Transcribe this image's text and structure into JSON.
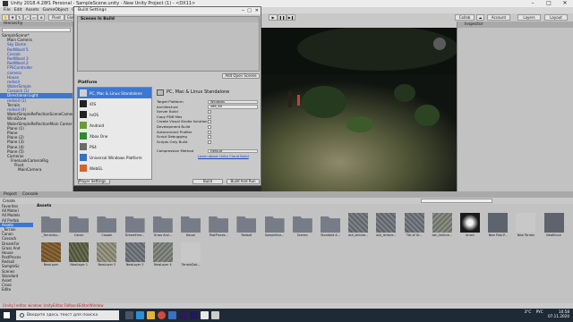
{
  "window": {
    "title": "Unity 2018.4.28f1 Personal - SampleScene.unity - New Unity Project (1) - <DX11>"
  },
  "menu": [
    "File",
    "Edit",
    "Assets",
    "GameObject",
    "Component",
    "Window",
    "Help"
  ],
  "toolbar": {
    "pivot": "Pivot",
    "space": "Global",
    "collab": "Collab",
    "account": "Account",
    "layers": "Layers",
    "layout": "Layout"
  },
  "hierarchy": {
    "title": "Hierarchy",
    "create": "Create",
    "items": [
      {
        "label": "SampleScene*",
        "cls": ""
      },
      {
        "label": "Main Camera",
        "cls": ""
      },
      {
        "label": "Sky Dome",
        "cls": "blue"
      },
      {
        "label": "RedWood 5",
        "cls": "blue"
      },
      {
        "label": "Cossak",
        "cls": "blue"
      },
      {
        "label": "RedWood 3",
        "cls": "blue"
      },
      {
        "label": "RedWood 2",
        "cls": "blue"
      },
      {
        "label": "FPSController",
        "cls": "blue"
      },
      {
        "label": "camera",
        "cls": "blue"
      },
      {
        "label": "House",
        "cls": "blue"
      },
      {
        "label": "redsoil",
        "cls": "blue"
      },
      {
        "label": "WaterSimple",
        "cls": "blue"
      },
      {
        "label": "Cossack (1)",
        "cls": "blue"
      },
      {
        "label": "Directional Light",
        "cls": "sel"
      },
      {
        "label": "redsoil (1)",
        "cls": "blue"
      },
      {
        "label": "Terrain",
        "cls": ""
      },
      {
        "label": "redsoil (4)",
        "cls": "blue"
      },
      {
        "label": "WaterSimpleReflectionSceneCamera",
        "cls": ""
      },
      {
        "label": "WindZone",
        "cls": ""
      },
      {
        "label": "WaterSimpleReflectionMain Camera",
        "cls": ""
      },
      {
        "label": "Plane (1)",
        "cls": ""
      },
      {
        "label": "Plane",
        "cls": ""
      },
      {
        "label": "Plane (2)",
        "cls": ""
      },
      {
        "label": "Plane (3)",
        "cls": ""
      },
      {
        "label": "Plane (4)",
        "cls": ""
      },
      {
        "label": "Plane (5)",
        "cls": ""
      },
      {
        "label": "Cameras",
        "cls": ""
      },
      {
        "label": "FreeLookCameraRig",
        "cls": ""
      },
      {
        "label": "Pivot",
        "cls": ""
      },
      {
        "label": "MainCamera",
        "cls": ""
      }
    ]
  },
  "inspector": {
    "title": "Inspector"
  },
  "build": {
    "title": "Build Settings",
    "scenes_header": "Scenes In Build",
    "add_open_scenes": "Add Open Scenes",
    "platform_header": "Platform",
    "platforms": [
      {
        "label": "PC, Mac & Linux Standalone",
        "color": "#d0d0d0"
      },
      {
        "label": "iOS",
        "color": "#222222"
      },
      {
        "label": "tvOS",
        "color": "#222222"
      },
      {
        "label": "Android",
        "color": "#6a9a3a"
      },
      {
        "label": "Xbox One",
        "color": "#2d8a2d"
      },
      {
        "label": "PS4",
        "color": "#6b6b6b"
      },
      {
        "label": "Universal Windows Platform",
        "color": "#3a6fc4"
      },
      {
        "label": "WebGL",
        "color": "#d9622b"
      }
    ],
    "selected_platform": "PC, Mac & Linux Standalone",
    "settings": [
      {
        "label": "Target Platform",
        "value": "Windows",
        "kind": "select"
      },
      {
        "label": "Architecture",
        "value": "x86_64",
        "kind": "select"
      },
      {
        "label": "Server Build",
        "value": "",
        "kind": "check"
      },
      {
        "label": "Copy PDB files",
        "value": "",
        "kind": "check"
      },
      {
        "label": "Create Visual Studio Solution",
        "value": "",
        "kind": "check"
      },
      {
        "label": "Development Build",
        "value": "",
        "kind": "check"
      },
      {
        "label": "Autoconnect Profiler",
        "value": "",
        "kind": "check"
      },
      {
        "label": "Script Debugging",
        "value": "",
        "kind": "check"
      },
      {
        "label": "Scripts Only Build",
        "value": "",
        "kind": "check"
      }
    ],
    "compression_label": "Compression Method",
    "compression_value": "Default",
    "cloud_link": "Learn about Unity Cloud Build",
    "player_settings": "Player Settings...",
    "build": "Build",
    "build_and_run": "Build And Run"
  },
  "project": {
    "tab_project": "Project",
    "tab_console": "Console",
    "create": "Create",
    "tree": [
      {
        "label": "Favorites",
        "cls": ""
      },
      {
        "label": "All Materi",
        "cls": ""
      },
      {
        "label": "All Models",
        "cls": ""
      },
      {
        "label": "All Prefab",
        "cls": ""
      },
      {
        "label": "Assets",
        "cls": "sel"
      },
      {
        "label": "_Terrain",
        "cls": ""
      },
      {
        "label": "Canon",
        "cls": ""
      },
      {
        "label": "Cossack",
        "cls": ""
      },
      {
        "label": "DreamFor",
        "cls": ""
      },
      {
        "label": "Grass And",
        "cls": ""
      },
      {
        "label": "House",
        "cls": ""
      },
      {
        "label": "PostProces",
        "cls": ""
      },
      {
        "label": "Redsoil",
        "cls": ""
      },
      {
        "label": "SampleSc",
        "cls": ""
      },
      {
        "label": "Scenes",
        "cls": ""
      },
      {
        "label": "Standard",
        "cls": ""
      },
      {
        "label": "Asset",
        "cls": ""
      },
      {
        "label": "Cross",
        "cls": ""
      },
      {
        "label": "Edito",
        "cls": ""
      }
    ],
    "crumb": "Assets",
    "assets": [
      {
        "label": "_TerrainAu...",
        "kind": "folder"
      },
      {
        "label": "Canon",
        "kind": "folder"
      },
      {
        "label": "Cossak",
        "kind": "folder"
      },
      {
        "label": "DreamFore...",
        "kind": "folder"
      },
      {
        "label": "Grass And...",
        "kind": "folder"
      },
      {
        "label": "House",
        "kind": "folder"
      },
      {
        "label": "PostProces...",
        "kind": "folder"
      },
      {
        "label": "Redsoil",
        "kind": "folder"
      },
      {
        "label": "SampleSce...",
        "kind": "folder"
      },
      {
        "label": "Scenes",
        "kind": "folder"
      },
      {
        "label": "Standard A...",
        "kind": "folder"
      },
      {
        "label": "ash_lenture...",
        "kind": "tex1"
      },
      {
        "label": "ash_lenture...",
        "kind": "tex1"
      },
      {
        "label": "Tile of Gr...",
        "kind": "tex1"
      },
      {
        "label": "ash_lenture...",
        "kind": "tex2"
      },
      {
        "label": "brush",
        "kind": "dark"
      },
      {
        "label": "New Post-P...",
        "kind": "unity"
      },
      {
        "label": "New Terrain",
        "kind": "cube"
      },
      {
        "label": "NewBrush",
        "kind": "unity"
      },
      {
        "label": "NewLayer",
        "kind": "soil"
      },
      {
        "label": "NewLayer 1",
        "kind": "soil2"
      },
      {
        "label": "NewLayer 2",
        "kind": "soil3"
      },
      {
        "label": "NewLayer 3",
        "kind": "tex1"
      },
      {
        "label": "NewLayer 4",
        "kind": "tex2"
      },
      {
        "label": "TerrainDat...",
        "kind": "cube"
      }
    ]
  },
  "status": "[Unity] editor window: UnityEditor.FallbackEditorWindow",
  "taskbar": {
    "search": "Введите здесь текст для поиска",
    "temp": "3°C",
    "lang": "РУС",
    "time": "10:58",
    "date": "07.11.2020"
  },
  "colors": {
    "accent": "#3d78d0",
    "taskbar": "#1f2a37"
  }
}
